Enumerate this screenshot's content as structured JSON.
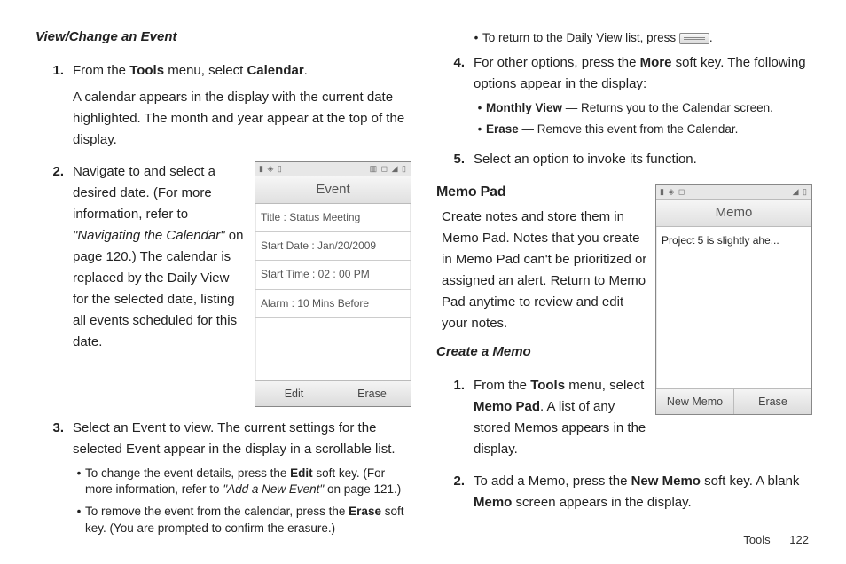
{
  "left": {
    "subhead": "View/Change an Event",
    "step1_a": "From the ",
    "step1_tools": "Tools",
    "step1_b": " menu, select ",
    "step1_cal": "Calendar",
    "step1_c": ".",
    "step1_p2": "A calendar appears in the display with the current date highlighted. The month and year appear at the top of the display.",
    "step2_a": "Navigate to and select a desired date. (For more information, refer to ",
    "step2_ref": "\"Navigating the Calendar\"",
    "step2_b": " on page 120.) The calendar is replaced by the Daily View for the selected date, listing all events scheduled for this date.",
    "step3_a": "Select an Event to view. The current settings for the selected Event appear in the display in a scrollable list.",
    "bul1_a": "To change the event details, press the ",
    "bul1_edit": "Edit",
    "bul1_b": " soft key. (For more information, refer to ",
    "bul1_ref": "\"Add a New Event\"",
    "bul1_c": " on page 121.)",
    "bul2_a": "To remove the event from the calendar, press the ",
    "bul2_erase": "Erase",
    "bul2_b": " soft key. (You are prompted to confirm the erasure.)"
  },
  "event_phone": {
    "title": "Event",
    "row1": "Title : Status Meeting",
    "row2": "Start Date : Jan/20/2009",
    "row3": "Start Time : 02 : 00 PM",
    "row4": "Alarm : 10 Mins Before",
    "sk_left": "Edit",
    "sk_right": "Erase"
  },
  "right": {
    "bul_return_a": "To return to the Daily View list, press ",
    "bul_return_b": ".",
    "step4_a": "For other options, press the ",
    "step4_more": "More",
    "step4_b": " soft key. The following options appear in the display:",
    "sub1_label": "Monthly View",
    "sub1_text": " — Returns you to the Calendar screen.",
    "sub2_label": "Erase",
    "sub2_text": " — Remove this event from the Calendar.",
    "step5": "Select an option to invoke its function.",
    "memo_head": "Memo Pad",
    "memo_intro": "Create notes and store them in Memo Pad. Notes that you create in Memo Pad can't be prioritized or assigned an alert. Return to Memo Pad anytime to review and edit your notes.",
    "memo_sub": "Create a Memo",
    "m1_a": "From the ",
    "m1_tools": "Tools",
    "m1_b": " menu, select ",
    "m1_pad": "Memo Pad",
    "m1_c": ". A list of any stored Memos appears in the display.",
    "m2_a": "To add a Memo, press the ",
    "m2_new": "New Memo",
    "m2_b": " soft key. A blank ",
    "m2_memo": "Memo",
    "m2_c": " screen appears in the display."
  },
  "memo_phone": {
    "title": "Memo",
    "row1": "Project 5 is slightly ahe...",
    "sk_left": "New Memo",
    "sk_right": "Erase"
  },
  "footer": {
    "section": "Tools",
    "page": "122"
  }
}
